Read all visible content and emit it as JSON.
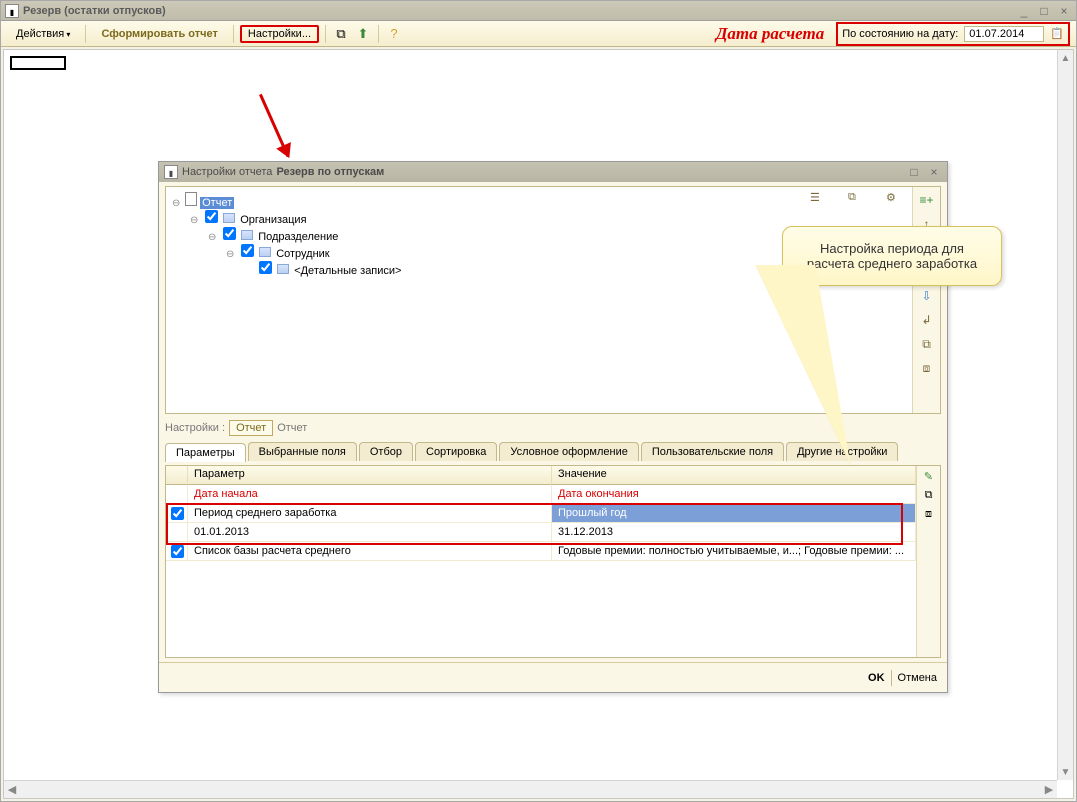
{
  "window": {
    "title": "Резерв (остатки отпусков)"
  },
  "toolbar": {
    "actions": "Действия",
    "generate": "Сформировать отчет",
    "settings": "Настройки...",
    "date_label": "По состоянию на дату:",
    "date_value": "01.07.2014",
    "annotation": "Дата расчета"
  },
  "dialog": {
    "title_prefix": "Настройки отчета",
    "title_bold": "Резерв по отпускам",
    "tree": {
      "root": "Отчет",
      "n1": "Организация",
      "n2": "Подразделение",
      "n3": "Сотрудник",
      "n4": "<Детальные записи>"
    },
    "breadcrumb": {
      "label": "Настройки :",
      "current": "Отчет",
      "trail": "Отчет"
    },
    "tabs": {
      "t1": "Параметры",
      "t2": "Выбранные поля",
      "t3": "Отбор",
      "t4": "Сортировка",
      "t5": "Условное оформление",
      "t6": "Пользовательские поля",
      "t7": "Другие настройки"
    },
    "params": {
      "h1": "Параметр",
      "h2": "Значение",
      "r1p": "Дата начала",
      "r1v": "Дата окончания",
      "r2p": "Период среднего заработка",
      "r2v": "Прошлый год",
      "r3p": "01.01.2013",
      "r3v": "31.12.2013",
      "r4p": "Список базы расчета среднего",
      "r4v": "Годовые премии: полностью учитываемые, и...; Годовые премии: ..."
    },
    "footer": {
      "ok": "OK",
      "cancel": "Отмена"
    }
  },
  "callout": {
    "text": "Настройка периода для расчета среднего заработка"
  }
}
